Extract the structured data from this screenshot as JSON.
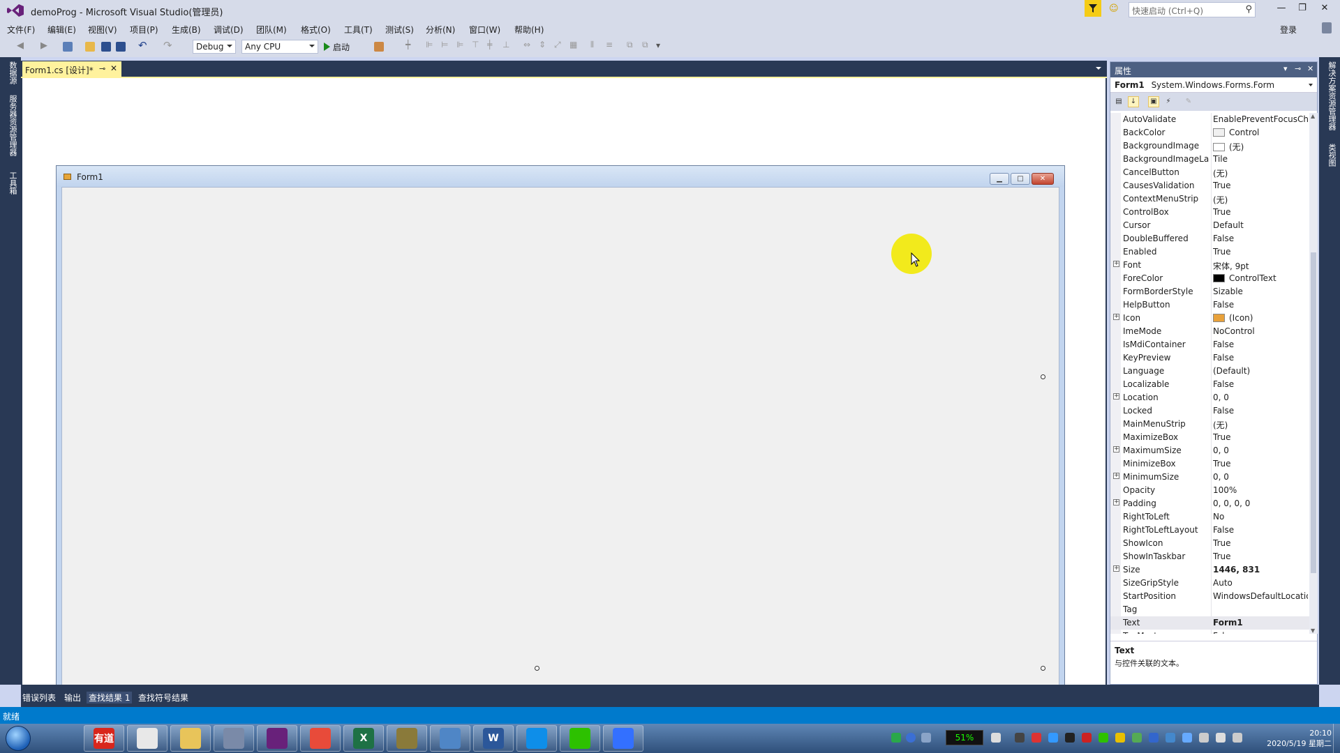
{
  "window": {
    "title": "demoProg - Microsoft Visual Studio(管理员)"
  },
  "quick_launch": {
    "placeholder": "快速启动 (Ctrl+Q)"
  },
  "menu": [
    "文件(F)",
    "编辑(E)",
    "视图(V)",
    "项目(P)",
    "生成(B)",
    "调试(D)",
    "团队(M)",
    "格式(O)",
    "工具(T)",
    "测试(S)",
    "分析(N)",
    "窗口(W)",
    "帮助(H)"
  ],
  "account": {
    "login": "登录"
  },
  "toolbar": {
    "config": "Debug",
    "platform": "Any CPU",
    "start": "启动"
  },
  "left_strip": {
    "tab1": "数据源",
    "tab2": "服务器资源管理器",
    "tab3": "工具箱"
  },
  "right_strip": {
    "tab1": "解决方案资源管理器",
    "tab2": "类视图"
  },
  "document_tab": {
    "label": "Form1.cs [设计]*",
    "pin": "⊸",
    "close": "✕"
  },
  "designer_form": {
    "caption": "Form1"
  },
  "properties": {
    "header": "属性",
    "object_name": "Form1",
    "object_type": "System.Windows.Forms.Form",
    "rows": [
      {
        "name": "AutoValidate",
        "value": "EnablePreventFocusCh"
      },
      {
        "name": "BackColor",
        "value": "Control",
        "swatch": "#f0f0f0"
      },
      {
        "name": "BackgroundImage",
        "value": "(无)",
        "swatch": "#ffffff"
      },
      {
        "name": "BackgroundImageLa",
        "value": "Tile"
      },
      {
        "name": "CancelButton",
        "value": "(无)"
      },
      {
        "name": "CausesValidation",
        "value": "True"
      },
      {
        "name": "ContextMenuStrip",
        "value": "(无)"
      },
      {
        "name": "ControlBox",
        "value": "True"
      },
      {
        "name": "Cursor",
        "value": "Default"
      },
      {
        "name": "DoubleBuffered",
        "value": "False"
      },
      {
        "name": "Enabled",
        "value": "True"
      },
      {
        "name": "Font",
        "value": "宋体, 9pt",
        "expand": true
      },
      {
        "name": "ForeColor",
        "value": "ControlText",
        "swatch": "#000000"
      },
      {
        "name": "FormBorderStyle",
        "value": "Sizable"
      },
      {
        "name": "HelpButton",
        "value": "False"
      },
      {
        "name": "Icon",
        "value": "(Icon)",
        "expand": true,
        "swatch": "#e8a13a"
      },
      {
        "name": "ImeMode",
        "value": "NoControl"
      },
      {
        "name": "IsMdiContainer",
        "value": "False"
      },
      {
        "name": "KeyPreview",
        "value": "False"
      },
      {
        "name": "Language",
        "value": "(Default)"
      },
      {
        "name": "Localizable",
        "value": "False"
      },
      {
        "name": "Location",
        "value": "0, 0",
        "expand": true
      },
      {
        "name": "Locked",
        "value": "False"
      },
      {
        "name": "MainMenuStrip",
        "value": "(无)"
      },
      {
        "name": "MaximizeBox",
        "value": "True"
      },
      {
        "name": "MaximumSize",
        "value": "0, 0",
        "expand": true
      },
      {
        "name": "MinimizeBox",
        "value": "True"
      },
      {
        "name": "MinimumSize",
        "value": "0, 0",
        "expand": true
      },
      {
        "name": "Opacity",
        "value": "100%"
      },
      {
        "name": "Padding",
        "value": "0, 0, 0, 0",
        "expand": true
      },
      {
        "name": "RightToLeft",
        "value": "No"
      },
      {
        "name": "RightToLeftLayout",
        "value": "False"
      },
      {
        "name": "ShowIcon",
        "value": "True"
      },
      {
        "name": "ShowInTaskbar",
        "value": "True"
      },
      {
        "name": "Size",
        "value": "1446, 831",
        "expand": true,
        "bold": true
      },
      {
        "name": "SizeGripStyle",
        "value": "Auto"
      },
      {
        "name": "StartPosition",
        "value": "WindowsDefaultLocatio"
      },
      {
        "name": "Tag",
        "value": ""
      },
      {
        "name": "Text",
        "value": "Form1",
        "bold": true,
        "selected": true
      },
      {
        "name": "TopMost",
        "value": "False"
      }
    ],
    "desc_title": "Text",
    "desc_text": "与控件关联的文本。"
  },
  "bottom_tabs": [
    "错误列表",
    "输出",
    "查找结果 1",
    "查找符号结果"
  ],
  "status": {
    "text": "就绪"
  },
  "taskbar": {
    "apps": [
      {
        "name": "youdao",
        "label": "有道",
        "color": "#d9261c"
      },
      {
        "name": "chrome",
        "label": "",
        "color": "#e8e8e8"
      },
      {
        "name": "explorer",
        "label": "",
        "color": "#e8c45a"
      },
      {
        "name": "movie-maker",
        "label": "",
        "color": "#7a8aa8"
      },
      {
        "name": "visual-studio",
        "label": "",
        "color": "#68217a"
      },
      {
        "name": "dictionary",
        "label": "",
        "color": "#e84b3a"
      },
      {
        "name": "excel",
        "label": "X",
        "color": "#1e7145"
      },
      {
        "name": "snail",
        "label": "",
        "color": "#8a7a3a"
      },
      {
        "name": "remote-desktop",
        "label": "",
        "color": "#4f86c6"
      },
      {
        "name": "word",
        "label": "W",
        "color": "#2b579a"
      },
      {
        "name": "teamviewer",
        "label": "",
        "color": "#0e8ee9"
      },
      {
        "name": "wechat",
        "label": "",
        "color": "#2dc100"
      },
      {
        "name": "feishu",
        "label": "",
        "color": "#3370ff"
      }
    ],
    "cpu": "51%",
    "time": "20:10",
    "date": "2020/5/19 星期二"
  },
  "colors": {
    "accent": "#007acc",
    "tab_active": "#fff29d",
    "chrome_dark": "#293955",
    "cursor_highlight": "#f2ea1c"
  }
}
